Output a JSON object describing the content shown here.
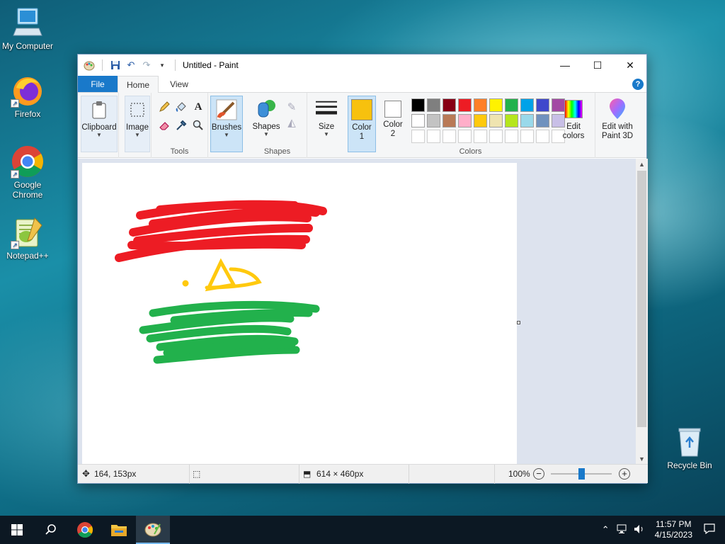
{
  "desktop": {
    "icons": [
      {
        "label": "My Computer",
        "icon": "computer-icon"
      },
      {
        "label": "Firefox",
        "icon": "firefox-icon"
      },
      {
        "label": "Google Chrome",
        "icon": "chrome-icon"
      },
      {
        "label": "Notepad++",
        "icon": "notepadpp-icon"
      },
      {
        "label": "Recycle Bin",
        "icon": "recycle-bin-icon"
      }
    ]
  },
  "window": {
    "title": "Untitled - Paint",
    "controls": {
      "minimize": "—",
      "maximize": "☐",
      "close": "✕"
    }
  },
  "tabs": {
    "file": "File",
    "home": "Home",
    "view": "View",
    "help": "?"
  },
  "ribbon": {
    "clipboard": "Clipboard",
    "image": "Image",
    "tools_group": "Tools",
    "brushes": "Brushes",
    "shapes": "Shapes",
    "shapes_group": "Shapes",
    "size": "Size",
    "color1": {
      "line1": "Color",
      "line2": "1",
      "value": "#f7c10e"
    },
    "color2": {
      "line1": "Color",
      "line2": "2",
      "value": "#ffffff"
    },
    "colors_group": "Colors",
    "edit_colors": {
      "line1": "Edit",
      "line2": "colors"
    },
    "edit_3d": {
      "line1": "Edit with",
      "line2": "Paint 3D"
    }
  },
  "palette": {
    "row1": [
      "#000000",
      "#7f7f7f",
      "#880015",
      "#ed1c24",
      "#ff7f27",
      "#fff200",
      "#22b14c",
      "#00a2e8",
      "#3f48cc",
      "#a349a4"
    ],
    "row2": [
      "#ffffff",
      "#c3c3c3",
      "#b97a57",
      "#ffaec9",
      "#ffc90e",
      "#efe4b0",
      "#b5e61d",
      "#99d9ea",
      "#7092be",
      "#c8bfe7"
    ]
  },
  "status": {
    "cursor_pos": "164, 153px",
    "image_size": "614 × 460px",
    "zoom": "100%",
    "zoom_level": 0.5
  },
  "taskbar": {
    "time": "11:57 PM",
    "date": "4/15/2023"
  }
}
